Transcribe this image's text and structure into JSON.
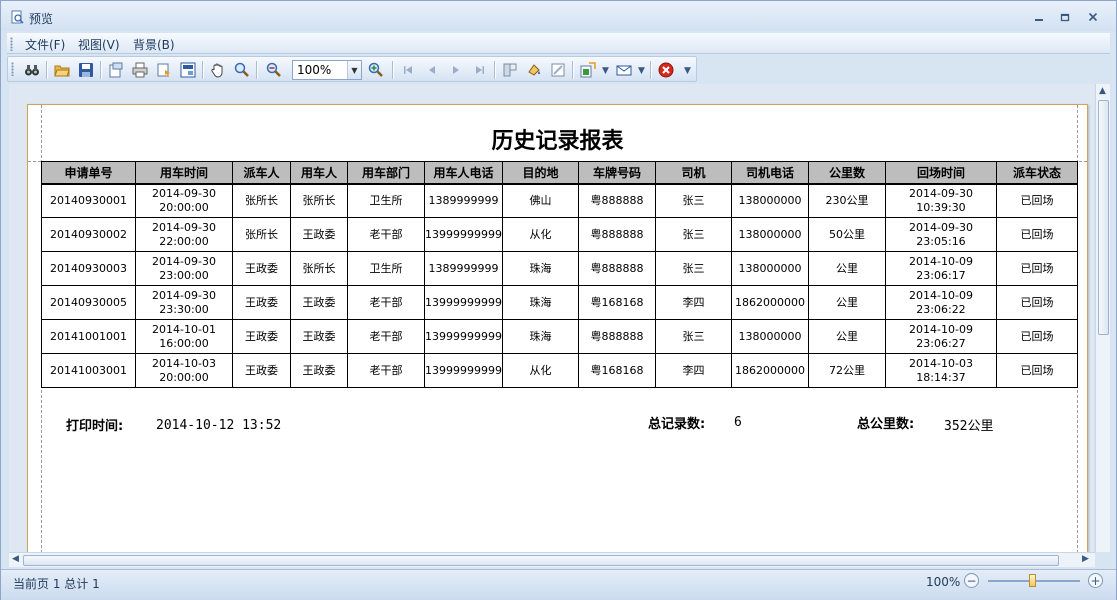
{
  "window": {
    "title": "预览"
  },
  "menu": [
    "文件(F)",
    "视图(V)",
    "背景(B)"
  ],
  "toolbar": {
    "zoom_value": "100%"
  },
  "report": {
    "title": "历史记录报表",
    "columns": [
      "申请单号",
      "用车时间",
      "派车人",
      "用车人",
      "用车部门",
      "用车人电话",
      "目的地",
      "车牌号码",
      "司机",
      "司机电话",
      "公里数",
      "回场时间",
      "派车状态"
    ],
    "rows": [
      [
        "20140930001",
        "2014-09-30 20:00:00",
        "张所长",
        "张所长",
        "卫生所",
        "1389999999",
        "佛山",
        "粤888888",
        "张三",
        "138000000",
        "230公里",
        "2014-09-30 10:39:30",
        "已回场"
      ],
      [
        "20140930002",
        "2014-09-30 22:00:00",
        "张所长",
        "王政委",
        "老干部",
        "13999999999",
        "从化",
        "粤888888",
        "张三",
        "138000000",
        "50公里",
        "2014-09-30 23:05:16",
        "已回场"
      ],
      [
        "20140930003",
        "2014-09-30 23:00:00",
        "王政委",
        "张所长",
        "卫生所",
        "1389999999",
        "珠海",
        "粤888888",
        "张三",
        "138000000",
        "公里",
        "2014-10-09 23:06:17",
        "已回场"
      ],
      [
        "20140930005",
        "2014-09-30 23:30:00",
        "王政委",
        "王政委",
        "老干部",
        "13999999999",
        "珠海",
        "粤168168",
        "李四",
        "1862000000",
        "公里",
        "2014-10-09 23:06:22",
        "已回场"
      ],
      [
        "20141001001",
        "2014-10-01 16:00:00",
        "王政委",
        "王政委",
        "老干部",
        "13999999999",
        "珠海",
        "粤888888",
        "张三",
        "138000000",
        "公里",
        "2014-10-09 23:06:27",
        "已回场"
      ],
      [
        "20141003001",
        "2014-10-03 20:00:00",
        "王政委",
        "王政委",
        "老干部",
        "13999999999",
        "从化",
        "粤168168",
        "李四",
        "1862000000",
        "72公里",
        "2014-10-03 18:14:37",
        "已回场"
      ]
    ],
    "print_time_label": "打印时间:",
    "print_time_value": "2014-10-12 13:52",
    "total_records_label": "总记录数:",
    "total_records_value": "6",
    "total_km_label": "总公里数:",
    "total_km_value": "352公里"
  },
  "status": {
    "page_info": "当前页 1 总计 1",
    "zoom": "100%"
  }
}
